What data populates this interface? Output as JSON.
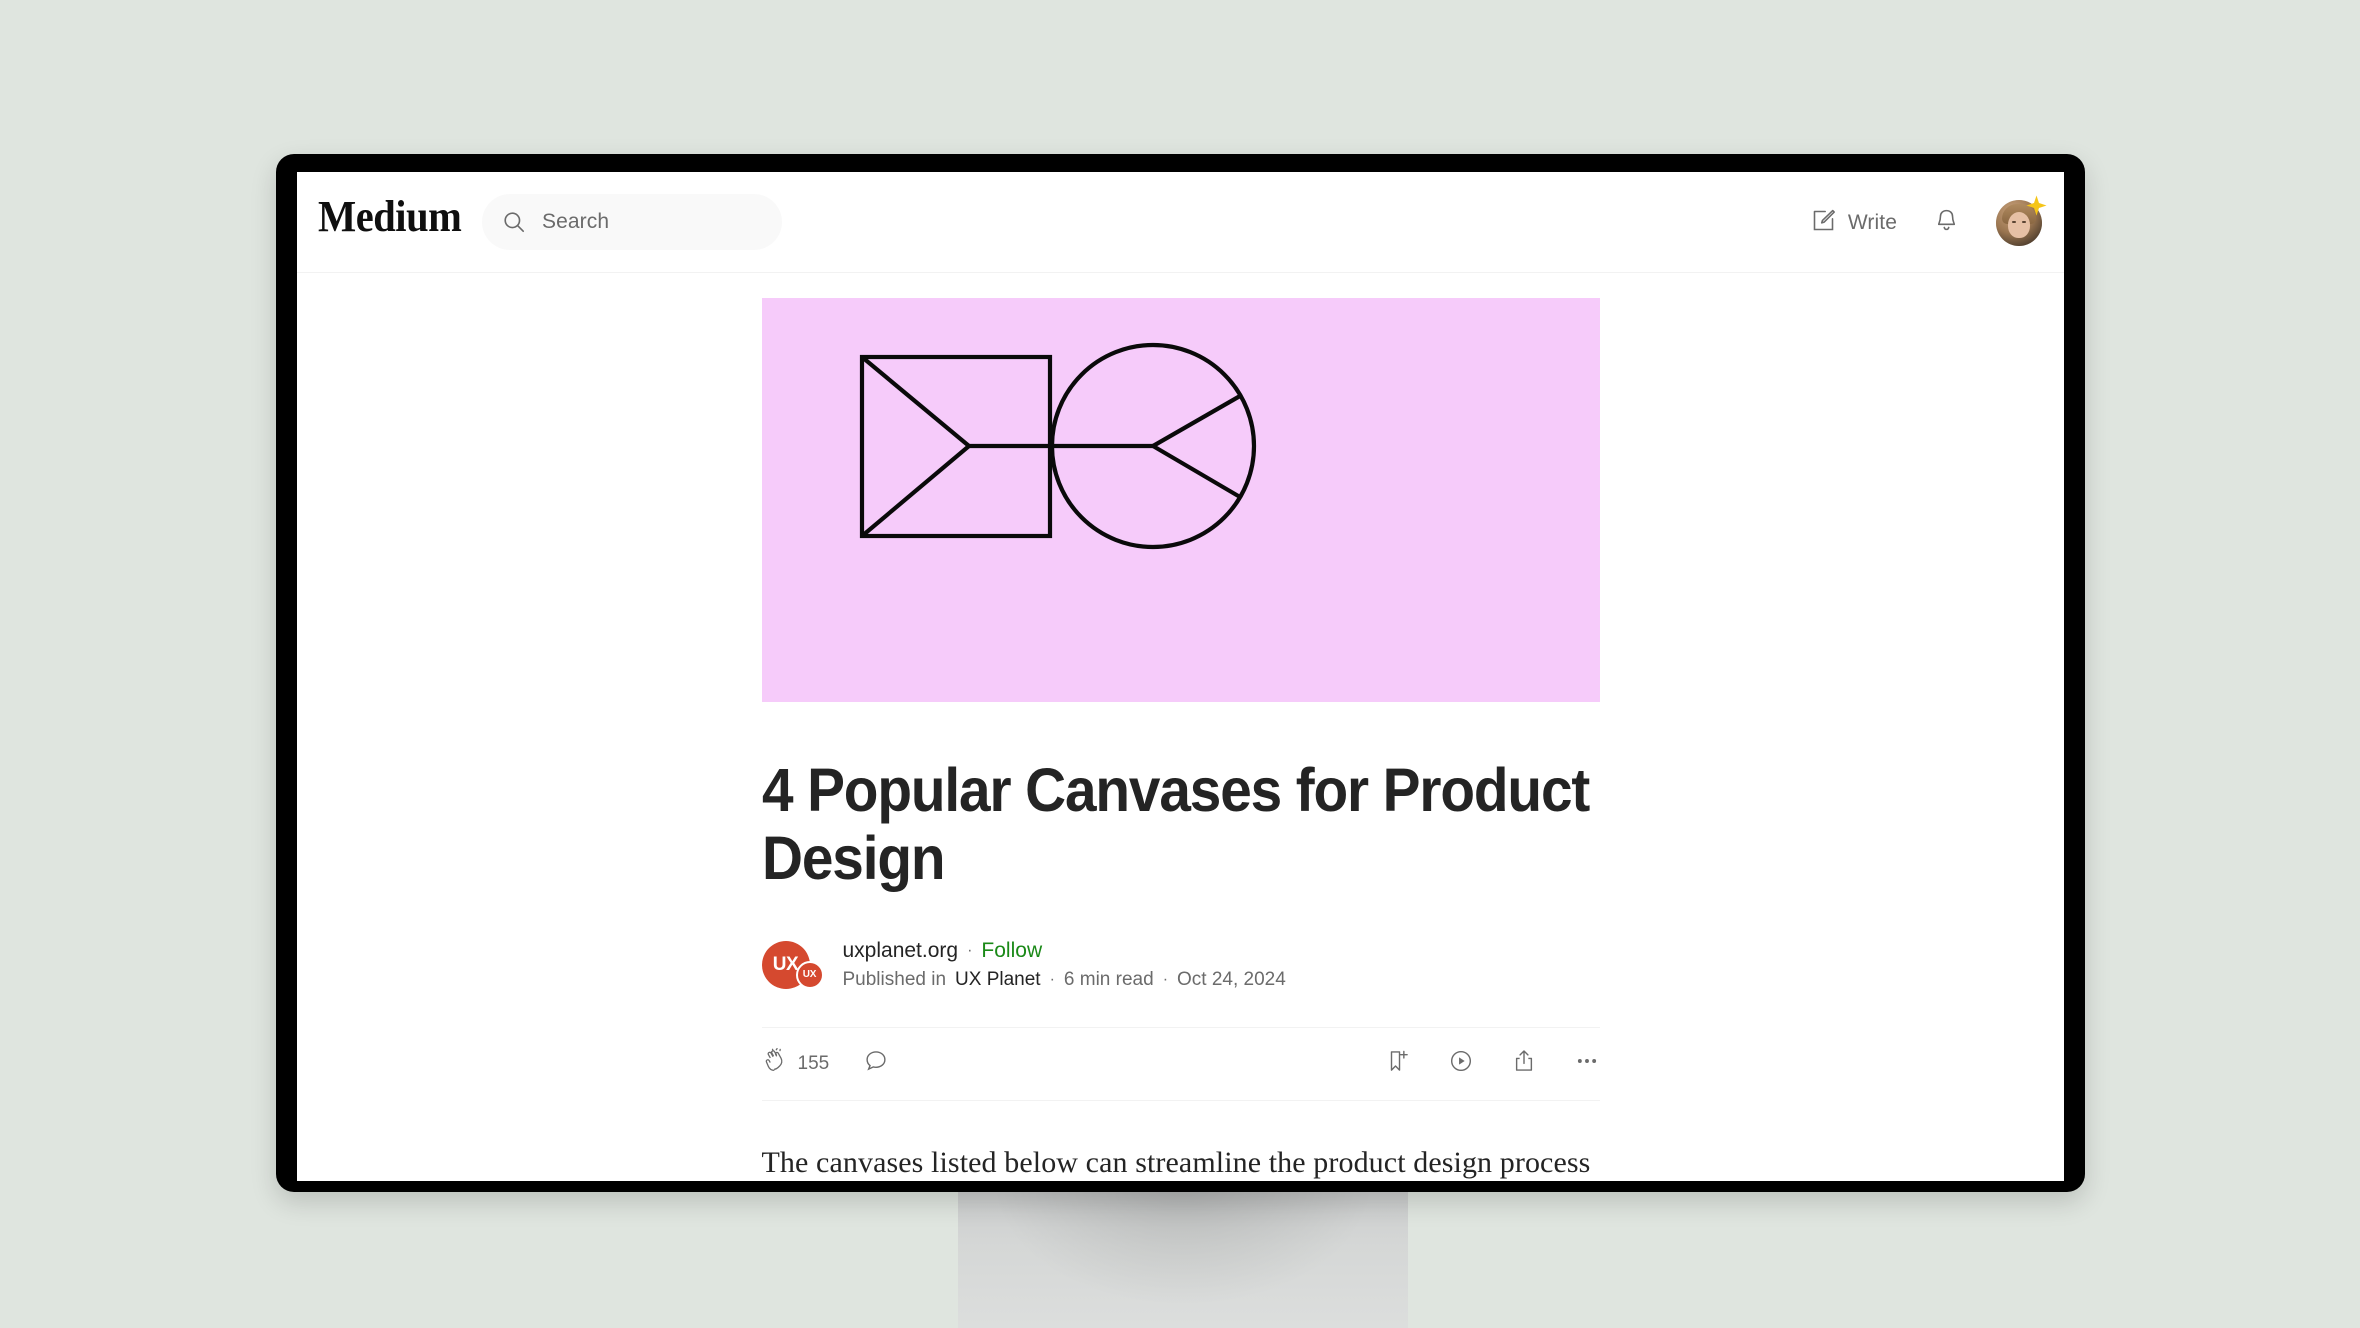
{
  "colors": {
    "page_background": "#dfe5df",
    "bezel": "#000000",
    "screen": "#ffffff",
    "hero_background": "#f6cbfa",
    "follow_green": "#1a8917",
    "publication_avatar": "#d5492f",
    "text_primary": "#242424",
    "text_secondary": "#6b6b6b",
    "star_badge": "#f5c518"
  },
  "navbar": {
    "brand": "Medium",
    "search": {
      "placeholder": "Search",
      "icon": "search-icon"
    },
    "write": {
      "label": "Write",
      "icon": "write-pencil-square-icon"
    },
    "notifications": {
      "icon": "bell-icon"
    },
    "avatar": {
      "name": "user-avatar",
      "badge_icon": "sparkle-star-icon"
    }
  },
  "article": {
    "hero": {
      "alt": "Two geometric canvas diagrams: a rectangle split by a Y shape and a circle split into three sectors",
      "background": "#f6cbfa",
      "shapes": [
        "rectangle-divided",
        "circle-divided"
      ]
    },
    "title": "4 Popular Canvases for Product Design",
    "byline": {
      "author": "uxplanet.org",
      "follow_label": "Follow",
      "separator": "·",
      "published_in_prefix": "Published in",
      "publication": "UX Planet",
      "read_time": "6 min read",
      "date": "Oct 24, 2024",
      "avatar_large_text": "UX",
      "avatar_small_text": "UX"
    },
    "engagement": {
      "clap_icon": "clap-icon",
      "clap_count": "155",
      "comment_icon": "comment-icon",
      "bookmark_icon": "bookmark-plus-icon",
      "listen_icon": "play-circle-icon",
      "share_icon": "share-icon",
      "more_icon": "ellipsis-icon"
    },
    "body_first_paragraph": "The canvases listed below can streamline the product design process and"
  }
}
